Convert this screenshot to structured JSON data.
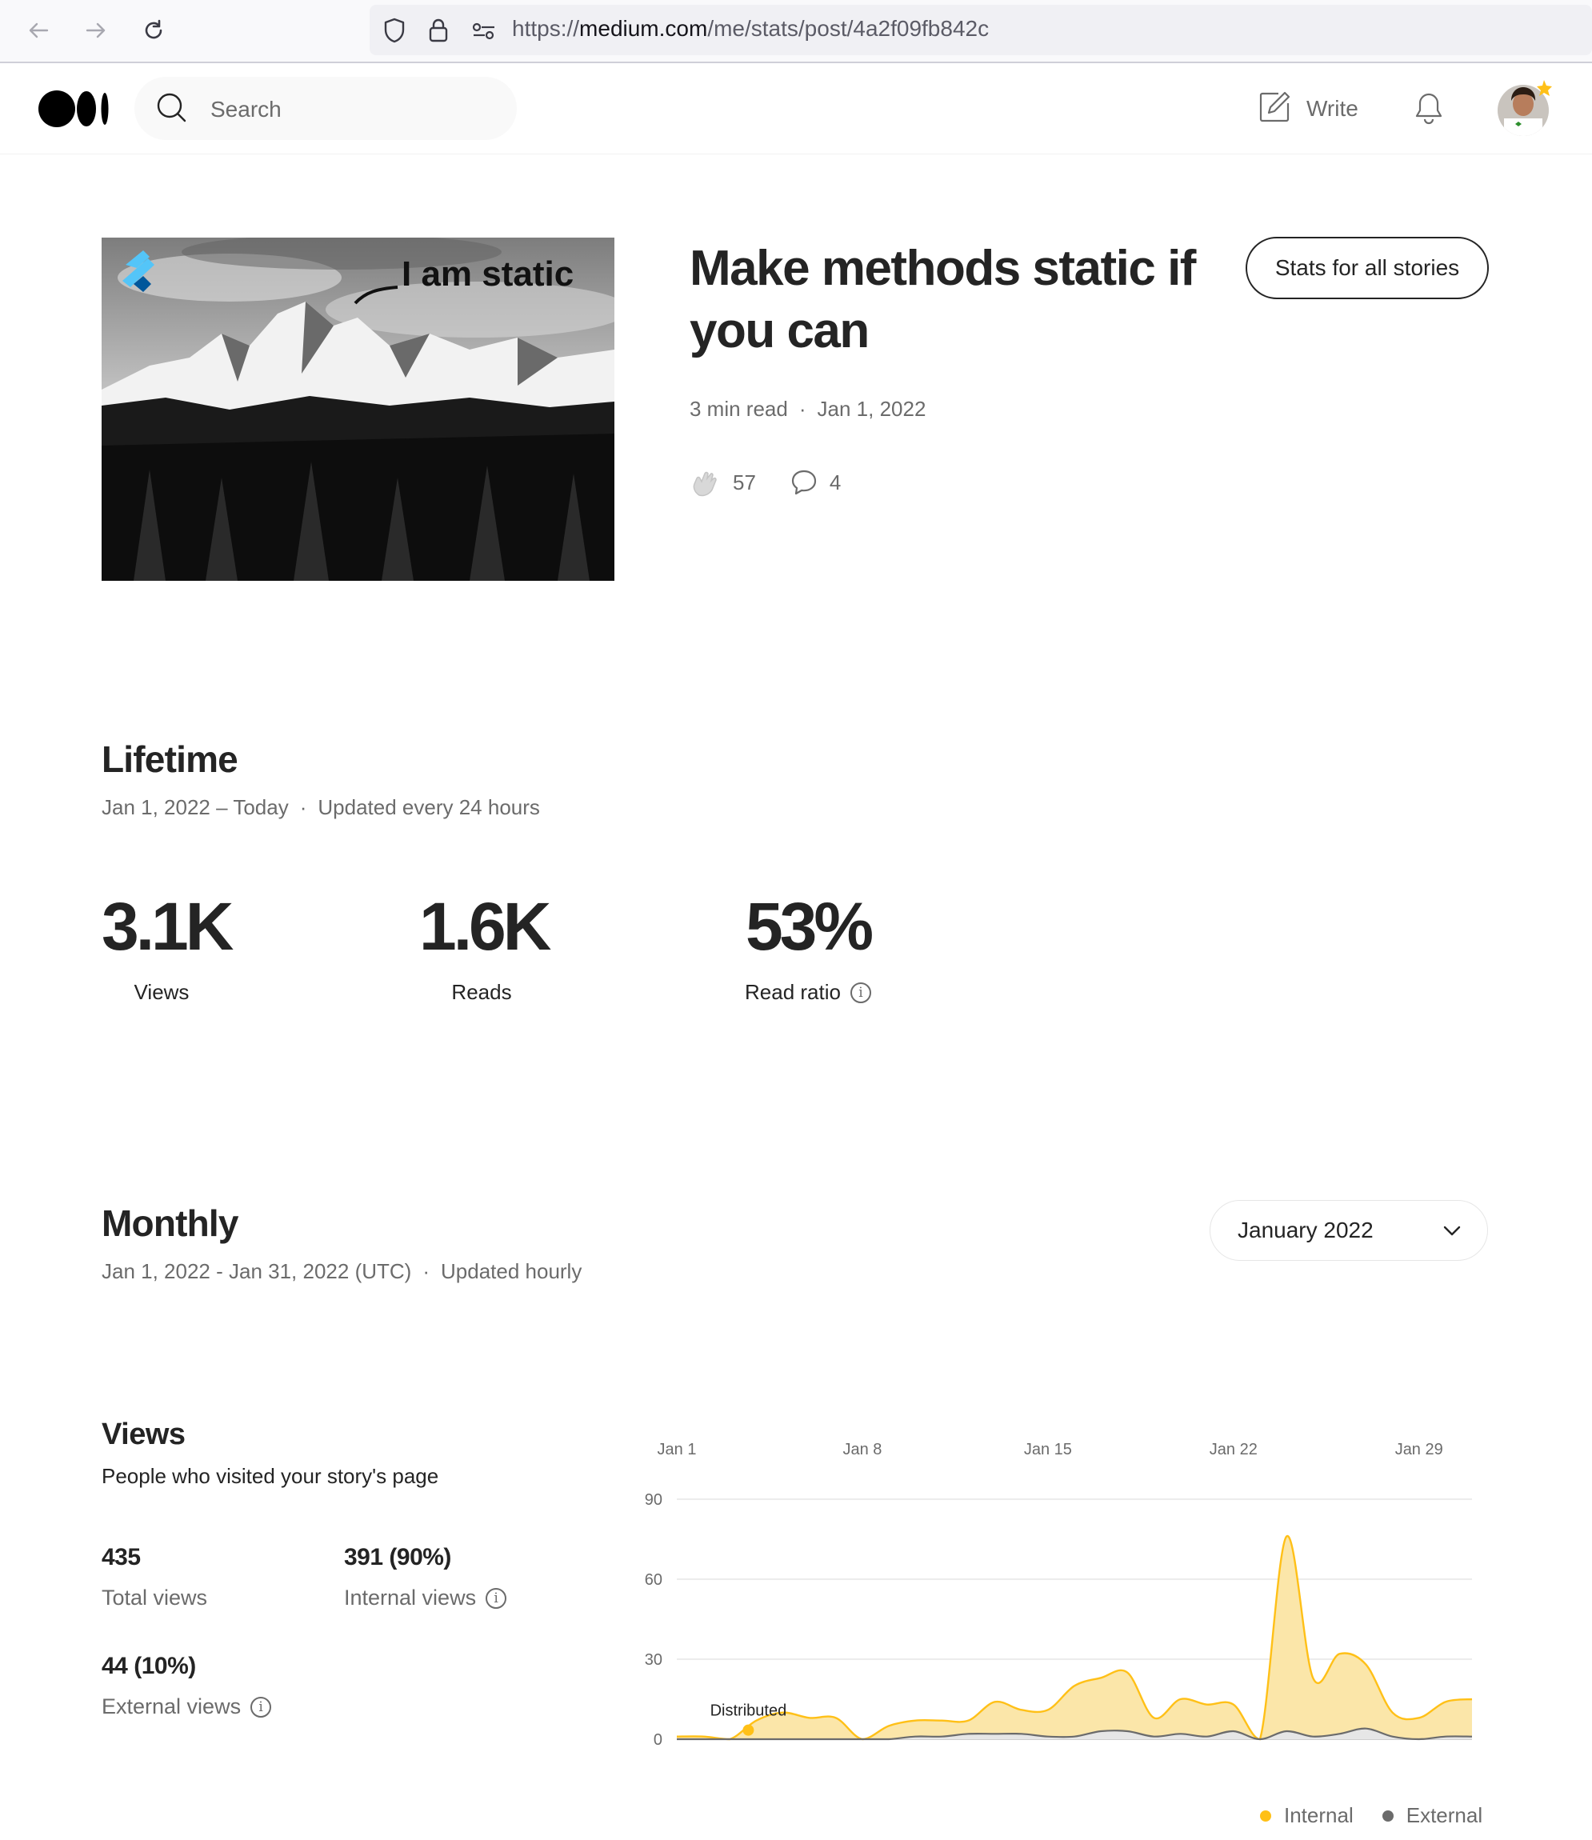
{
  "browser": {
    "url_scheme": "https://",
    "url_host": "medium.com",
    "url_path": "/me/stats/post/4a2f09fb842c"
  },
  "header": {
    "search_placeholder": "Search",
    "write_label": "Write"
  },
  "post": {
    "title": "Make methods static if you can",
    "read_time": "3 min read",
    "published": "Jan 1, 2022",
    "claps": "57",
    "responses": "4",
    "hero_caption": "I am static",
    "stats_all_label": "Stats for all stories"
  },
  "lifetime": {
    "title": "Lifetime",
    "range": "Jan 1, 2022 – Today",
    "update": "Updated every 24 hours",
    "stats": [
      {
        "value": "3.1K",
        "label": "Views"
      },
      {
        "value": "1.6K",
        "label": "Reads"
      },
      {
        "value": "53%",
        "label": "Read ratio"
      }
    ]
  },
  "monthly": {
    "title": "Monthly",
    "range": "Jan 1, 2022 - Jan 31, 2022 (UTC)",
    "update": "Updated hourly",
    "selected_month": "January 2022"
  },
  "views": {
    "title": "Views",
    "subtitle": "People who visited your story's page",
    "total_value": "435",
    "total_label": "Total views",
    "internal_value": "391 (90%)",
    "internal_label": "Internal views",
    "external_value": "44 (10%)",
    "external_label": "External views"
  },
  "chart_data": {
    "type": "area",
    "x": [
      "Jan 1",
      "Jan 2",
      "Jan 3",
      "Jan 4",
      "Jan 5",
      "Jan 6",
      "Jan 7",
      "Jan 8",
      "Jan 9",
      "Jan 10",
      "Jan 11",
      "Jan 12",
      "Jan 13",
      "Jan 14",
      "Jan 15",
      "Jan 16",
      "Jan 17",
      "Jan 18",
      "Jan 19",
      "Jan 20",
      "Jan 21",
      "Jan 22",
      "Jan 23",
      "Jan 24",
      "Jan 25",
      "Jan 26",
      "Jan 27",
      "Jan 28",
      "Jan 29",
      "Jan 30",
      "Jan 31"
    ],
    "x_ticks": [
      "Jan 1",
      "Jan 8",
      "Jan 15",
      "Jan 22",
      "Jan 29"
    ],
    "y_ticks": [
      0,
      30,
      60,
      90
    ],
    "ylim": [
      0,
      90
    ],
    "series": [
      {
        "name": "Internal",
        "color": "#ffc017",
        "fill": "#fbe6a9",
        "values": [
          1,
          1,
          0,
          7,
          10,
          8,
          8,
          0,
          5,
          7,
          7,
          7,
          14,
          11,
          11,
          20,
          23,
          25,
          8,
          15,
          13,
          13,
          0,
          76,
          23,
          32,
          28,
          10,
          8,
          14,
          15
        ]
      },
      {
        "name": "External",
        "color": "#6b6b6b",
        "fill": "#e6e6e6",
        "values": [
          0,
          0,
          0,
          0,
          0,
          0,
          0,
          0,
          0,
          1,
          1,
          2,
          2,
          2,
          1,
          1,
          3,
          3,
          1,
          2,
          1,
          3,
          0,
          3,
          1,
          2,
          4,
          1,
          0,
          1,
          1
        ]
      }
    ],
    "annotations": [
      {
        "x": "Jan 4",
        "label": "Distributed"
      }
    ],
    "legend_position": "bottom-right",
    "grid": true
  }
}
